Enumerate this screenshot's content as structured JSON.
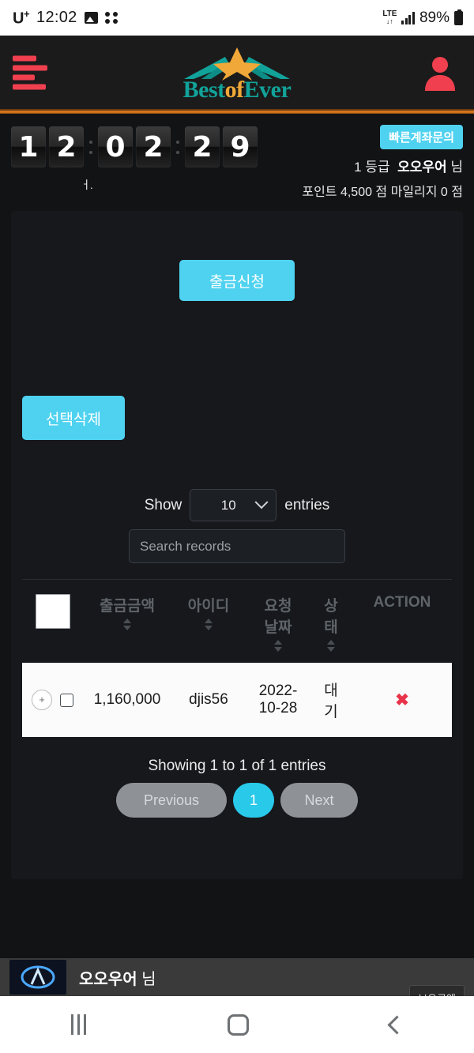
{
  "statusbar": {
    "carrier": "U",
    "carrier_sup": "+",
    "time": "12:02",
    "photo_icon": "photo-icon",
    "dots_icon": "dots-grid-icon",
    "network": "LTE",
    "network_arrows": "↓↑",
    "battery": "89%"
  },
  "header": {
    "menu_icon": "hamburger-menu-icon",
    "logo_part1": "Best",
    "logo_part2": "of",
    "logo_part3": "Ever",
    "logo_mark": "star-wings-logo-icon",
    "avatar_icon": "user-avatar-icon"
  },
  "info": {
    "clock_digits": [
      "1",
      "2",
      "0",
      "2",
      "2",
      "9"
    ],
    "quick_account_badge": "빠른계좌문의",
    "rank": "1 등급",
    "user_name": "오오우어",
    "user_suffix": "님",
    "points_line": "포인트 4,500 점   마일리지 0 점",
    "tiny_glyph": "ㅓ."
  },
  "actions": {
    "withdraw_request": "출금신청",
    "delete_selected": "선택삭제"
  },
  "datatable": {
    "show_label": "Show",
    "entries_label": "entries",
    "page_length": "10",
    "search_placeholder": "Search records",
    "search_value": "",
    "columns": [
      "출금금액",
      "아이디",
      "요청 날짜",
      "상 태",
      "ACTION"
    ],
    "col_request_date_l1": "요청",
    "col_request_date_l2": "날짜",
    "col_status_l1": "상",
    "col_status_l2": "태",
    "rows": [
      {
        "expand": "+",
        "amount": "1,160,000",
        "id": "djis56",
        "date_l1": "2022-",
        "date_l2": "10-28",
        "status_l1": "대",
        "status_l2": "기",
        "action": "✖"
      }
    ],
    "showing_info": "Showing 1 to 1 of 1 entries",
    "previous": "Previous",
    "current_page": "1",
    "next": "Next"
  },
  "bottom_panel": {
    "user_name": "오오우어",
    "user_suffix": "님",
    "thumb_icon": "video-thumbnail-icon",
    "side_button": "보유금액"
  },
  "navbar": {
    "recents": "recents-icon",
    "home": "home-icon",
    "back": "back-icon"
  },
  "colors": {
    "accent_cyan": "#4fd2f0",
    "page_cyan": "#29c9ea",
    "brand_red": "#f0404f",
    "brand_teal": "#11a39a",
    "brand_gold": "#f0a838",
    "divider_orange": "#d4741a",
    "delete_red": "#e8344a"
  }
}
